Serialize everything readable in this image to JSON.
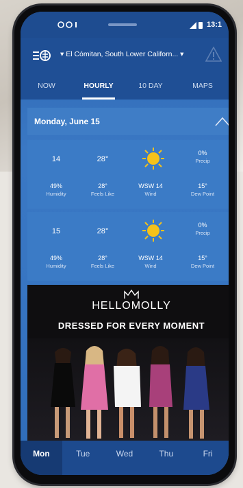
{
  "status": {
    "left": "☉ ⛄!",
    "time": "13:1"
  },
  "header": {
    "location": "El Cómitan, South Lower Californ..."
  },
  "tabs": [
    "NOW",
    "HOURLY",
    "10 DAY",
    "MAPS"
  ],
  "date_row": {
    "date": "Monday, June 15"
  },
  "hours": [
    {
      "hour": "14",
      "temp": "28°",
      "precip": "0%",
      "precip_label": "Precip",
      "humidity": "49%",
      "humidity_label": "Humidity",
      "feels": "28°",
      "feels_label": "Feels Like",
      "wind": "WSW 14",
      "wind_label": "Wind",
      "dew": "15°",
      "dew_label": "Dew Point"
    },
    {
      "hour": "15",
      "temp": "28°",
      "precip": "0%",
      "precip_label": "Precip",
      "humidity": "49%",
      "humidity_label": "Humidity",
      "feels": "28°",
      "feels_label": "Feels Like",
      "wind": "WSW 14",
      "wind_label": "Wind",
      "dew": "15°",
      "dew_label": "Dew Point"
    }
  ],
  "ad": {
    "brand": "HELLOMOLLY",
    "tagline": "DRESSED FOR EVERY MOMENT"
  },
  "days": [
    "Mon",
    "Tue",
    "Wed",
    "Thu",
    "Fri"
  ],
  "colors": {
    "header": "#1f4f95",
    "card": "#3b7bc6",
    "sun": "#f5c21a"
  }
}
